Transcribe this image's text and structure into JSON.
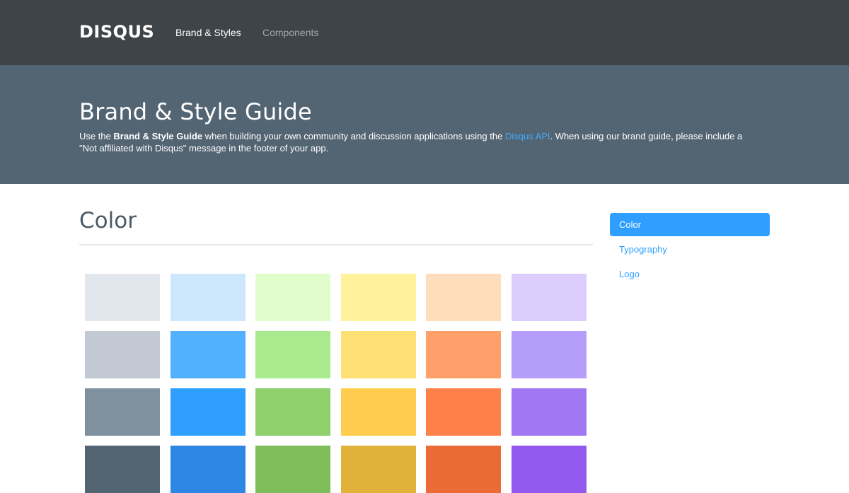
{
  "header": {
    "logo": "DISQUS",
    "nav": [
      {
        "label": "Brand & Styles",
        "active": true
      },
      {
        "label": "Components",
        "active": false
      }
    ]
  },
  "hero": {
    "title": "Brand & Style Guide",
    "intro_prefix": "Use the ",
    "intro_bold": "Brand & Style Guide",
    "intro_middle": " when building your own community and discussion applications using the ",
    "intro_link": "Disqus API",
    "intro_suffix": ". When using our brand guide, please include a \"Not affiliated with Disqus\" message in the footer of your app."
  },
  "main": {
    "section_title": "Color",
    "swatches": [
      [
        "#e2e6ed",
        "#cde7fd",
        "#e2fdcc",
        "#fff29a",
        "#feddbd",
        "#ddcdfd"
      ],
      [
        "#c2c9d3",
        "#52b0fe",
        "#a8ea8d",
        "#fee075",
        "#ffa06a",
        "#b59dfc"
      ],
      [
        "#7f919f",
        "#2e9fff",
        "#8ed06c",
        "#fecd4d",
        "#ff8048",
        "#a277f4"
      ],
      [
        "#536473",
        "#2e87e5",
        "#7fbc5a",
        "#e0b23a",
        "#ea6b35",
        "#9359ef"
      ]
    ]
  },
  "sidebar": {
    "items": [
      {
        "label": "Color",
        "active": true
      },
      {
        "label": "Typography",
        "active": false
      },
      {
        "label": "Logo",
        "active": false
      }
    ]
  }
}
